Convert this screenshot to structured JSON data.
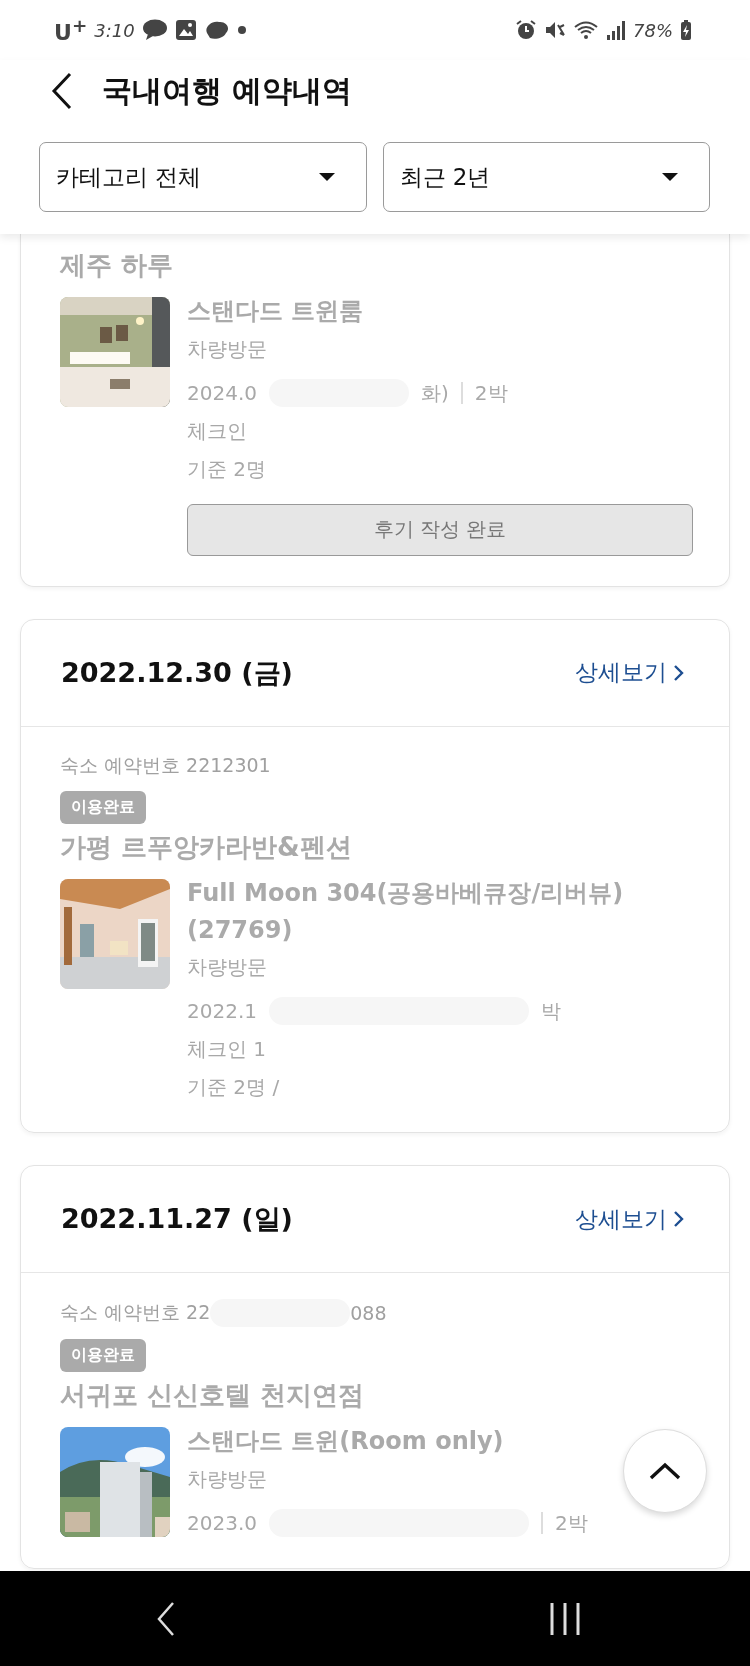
{
  "status_bar": {
    "carrier": "U$^{+}$",
    "time": "3:10",
    "battery": "78%"
  },
  "header": {
    "title": "국내여행 예약내역"
  },
  "filters": [
    {
      "label": "카테고리 전체"
    },
    {
      "label": "최근 2년"
    }
  ],
  "bookings": [
    {
      "name": "제주 하루",
      "room": [
        "스탠다드 트윈룸"
      ],
      "visit": "차량방문",
      "dates": [
        "2024.0",
        "화)"
      ],
      "nights": "2박",
      "separator": true,
      "checkin": [
        "체크인"
      ],
      "guests": [
        "기준 2명"
      ],
      "review_button": "후기 작성 완료"
    },
    {
      "date": "2022.12.30 (금)",
      "detail_link": "상세보기",
      "reservation_no": [
        "숙소 예약번호 2212301"
      ],
      "status": "이용완료",
      "name": "가평 르푸앙카라반&펜션",
      "room": [
        "Full Moon 304(공용바베큐장/리버뷰)",
        "(27769)"
      ],
      "visit": "차량방문",
      "dates": [
        "2022.1"
      ],
      "nights": "박",
      "separator": false,
      "checkin": [
        "체크인 1"
      ],
      "guests": [
        "기준 2명 /"
      ]
    },
    {
      "date": "2022.11.27 (일)",
      "detail_link": "상세보기",
      "reservation_no": [
        "숙소 예약번호 22",
        "088"
      ],
      "status": "이용완료",
      "name": "서귀포 신신호텔 천지연점",
      "room": [
        "스탠다드 트윈(Room only)"
      ],
      "visit": "차량방문",
      "dates": [
        "2023.0"
      ],
      "nights": "2박",
      "separator": true
    }
  ]
}
